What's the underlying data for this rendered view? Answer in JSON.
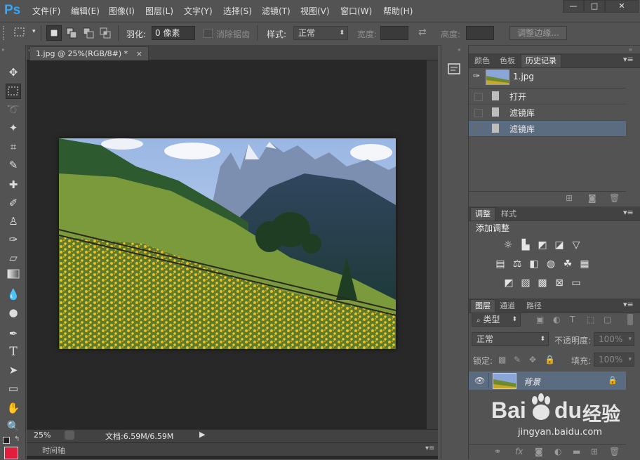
{
  "app": {
    "logo": "Ps"
  },
  "menu": [
    "文件(F)",
    "编辑(E)",
    "图像(I)",
    "图层(L)",
    "文字(Y)",
    "选择(S)",
    "滤镜(T)",
    "视图(V)",
    "窗口(W)",
    "帮助(H)"
  ],
  "window_controls": {
    "minimize": "—",
    "maximize": "□",
    "close": "✕"
  },
  "options": {
    "feather_label": "羽化:",
    "feather_value": "0 像素",
    "antialias_label": "消除锯齿",
    "style_label": "样式:",
    "style_value": "正常",
    "width_label": "宽度:",
    "height_label": "高度:",
    "refine_button": "调整边缘..."
  },
  "document": {
    "tab_title": "1.jpg @ 25%(RGB/8#) *",
    "tab_close": "×",
    "zoom": "25%",
    "doc_info": "文档:6.59M/6.59M"
  },
  "timeline": {
    "label": "时间轴"
  },
  "history_panel": {
    "tabs": [
      "颜色",
      "色板",
      "历史记录"
    ],
    "active_tab": "历史记录",
    "snapshot_label": "1.jpg",
    "states": [
      "打开",
      "滤镜库",
      "滤镜库"
    ],
    "selected_index": 2
  },
  "adjustments_panel": {
    "tabs": [
      "调整",
      "样式"
    ],
    "heading": "添加调整"
  },
  "layers_panel": {
    "tabs": [
      "图层",
      "通道",
      "路径"
    ],
    "filter_label": "类型",
    "blend_mode": "正常",
    "opacity_label": "不透明度:",
    "opacity_value": "100%",
    "lock_label": "锁定:",
    "fill_label": "填充:",
    "fill_value": "100%",
    "layer_name": "背景"
  },
  "watermark": {
    "brand": "Bai",
    "brand2": "du",
    "suffix": "经验",
    "url": "jingyan.baidu.com"
  },
  "colors": {
    "foreground": "#e31e3c",
    "selected_row": "#5b6b80",
    "accent": "#31a8ff"
  }
}
